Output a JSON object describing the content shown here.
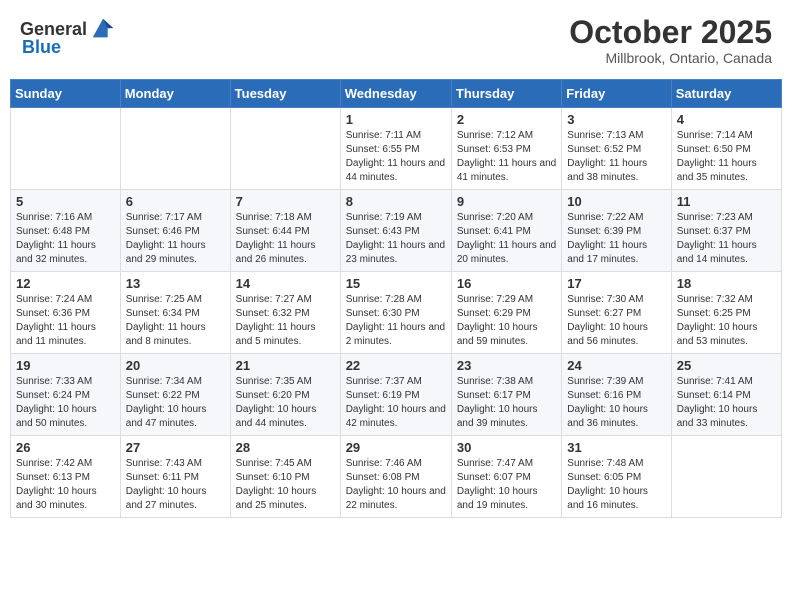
{
  "header": {
    "logo_general": "General",
    "logo_blue": "Blue",
    "month": "October 2025",
    "location": "Millbrook, Ontario, Canada"
  },
  "weekdays": [
    "Sunday",
    "Monday",
    "Tuesday",
    "Wednesday",
    "Thursday",
    "Friday",
    "Saturday"
  ],
  "weeks": [
    [
      {
        "day": "",
        "info": ""
      },
      {
        "day": "",
        "info": ""
      },
      {
        "day": "",
        "info": ""
      },
      {
        "day": "1",
        "info": "Sunrise: 7:11 AM\nSunset: 6:55 PM\nDaylight: 11 hours and 44 minutes."
      },
      {
        "day": "2",
        "info": "Sunrise: 7:12 AM\nSunset: 6:53 PM\nDaylight: 11 hours and 41 minutes."
      },
      {
        "day": "3",
        "info": "Sunrise: 7:13 AM\nSunset: 6:52 PM\nDaylight: 11 hours and 38 minutes."
      },
      {
        "day": "4",
        "info": "Sunrise: 7:14 AM\nSunset: 6:50 PM\nDaylight: 11 hours and 35 minutes."
      }
    ],
    [
      {
        "day": "5",
        "info": "Sunrise: 7:16 AM\nSunset: 6:48 PM\nDaylight: 11 hours and 32 minutes."
      },
      {
        "day": "6",
        "info": "Sunrise: 7:17 AM\nSunset: 6:46 PM\nDaylight: 11 hours and 29 minutes."
      },
      {
        "day": "7",
        "info": "Sunrise: 7:18 AM\nSunset: 6:44 PM\nDaylight: 11 hours and 26 minutes."
      },
      {
        "day": "8",
        "info": "Sunrise: 7:19 AM\nSunset: 6:43 PM\nDaylight: 11 hours and 23 minutes."
      },
      {
        "day": "9",
        "info": "Sunrise: 7:20 AM\nSunset: 6:41 PM\nDaylight: 11 hours and 20 minutes."
      },
      {
        "day": "10",
        "info": "Sunrise: 7:22 AM\nSunset: 6:39 PM\nDaylight: 11 hours and 17 minutes."
      },
      {
        "day": "11",
        "info": "Sunrise: 7:23 AM\nSunset: 6:37 PM\nDaylight: 11 hours and 14 minutes."
      }
    ],
    [
      {
        "day": "12",
        "info": "Sunrise: 7:24 AM\nSunset: 6:36 PM\nDaylight: 11 hours and 11 minutes."
      },
      {
        "day": "13",
        "info": "Sunrise: 7:25 AM\nSunset: 6:34 PM\nDaylight: 11 hours and 8 minutes."
      },
      {
        "day": "14",
        "info": "Sunrise: 7:27 AM\nSunset: 6:32 PM\nDaylight: 11 hours and 5 minutes."
      },
      {
        "day": "15",
        "info": "Sunrise: 7:28 AM\nSunset: 6:30 PM\nDaylight: 11 hours and 2 minutes."
      },
      {
        "day": "16",
        "info": "Sunrise: 7:29 AM\nSunset: 6:29 PM\nDaylight: 10 hours and 59 minutes."
      },
      {
        "day": "17",
        "info": "Sunrise: 7:30 AM\nSunset: 6:27 PM\nDaylight: 10 hours and 56 minutes."
      },
      {
        "day": "18",
        "info": "Sunrise: 7:32 AM\nSunset: 6:25 PM\nDaylight: 10 hours and 53 minutes."
      }
    ],
    [
      {
        "day": "19",
        "info": "Sunrise: 7:33 AM\nSunset: 6:24 PM\nDaylight: 10 hours and 50 minutes."
      },
      {
        "day": "20",
        "info": "Sunrise: 7:34 AM\nSunset: 6:22 PM\nDaylight: 10 hours and 47 minutes."
      },
      {
        "day": "21",
        "info": "Sunrise: 7:35 AM\nSunset: 6:20 PM\nDaylight: 10 hours and 44 minutes."
      },
      {
        "day": "22",
        "info": "Sunrise: 7:37 AM\nSunset: 6:19 PM\nDaylight: 10 hours and 42 minutes."
      },
      {
        "day": "23",
        "info": "Sunrise: 7:38 AM\nSunset: 6:17 PM\nDaylight: 10 hours and 39 minutes."
      },
      {
        "day": "24",
        "info": "Sunrise: 7:39 AM\nSunset: 6:16 PM\nDaylight: 10 hours and 36 minutes."
      },
      {
        "day": "25",
        "info": "Sunrise: 7:41 AM\nSunset: 6:14 PM\nDaylight: 10 hours and 33 minutes."
      }
    ],
    [
      {
        "day": "26",
        "info": "Sunrise: 7:42 AM\nSunset: 6:13 PM\nDaylight: 10 hours and 30 minutes."
      },
      {
        "day": "27",
        "info": "Sunrise: 7:43 AM\nSunset: 6:11 PM\nDaylight: 10 hours and 27 minutes."
      },
      {
        "day": "28",
        "info": "Sunrise: 7:45 AM\nSunset: 6:10 PM\nDaylight: 10 hours and 25 minutes."
      },
      {
        "day": "29",
        "info": "Sunrise: 7:46 AM\nSunset: 6:08 PM\nDaylight: 10 hours and 22 minutes."
      },
      {
        "day": "30",
        "info": "Sunrise: 7:47 AM\nSunset: 6:07 PM\nDaylight: 10 hours and 19 minutes."
      },
      {
        "day": "31",
        "info": "Sunrise: 7:48 AM\nSunset: 6:05 PM\nDaylight: 10 hours and 16 minutes."
      },
      {
        "day": "",
        "info": ""
      }
    ]
  ]
}
